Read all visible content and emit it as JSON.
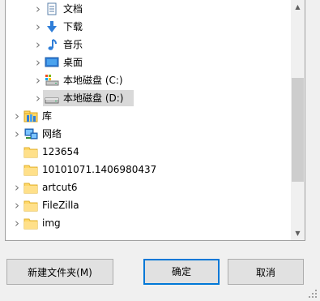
{
  "tree": {
    "items": [
      {
        "label": "文档",
        "icon": "document-icon",
        "expandable": true,
        "level": 2
      },
      {
        "label": "下载",
        "icon": "download-icon",
        "expandable": true,
        "level": 2
      },
      {
        "label": "音乐",
        "icon": "music-icon",
        "expandable": true,
        "level": 2
      },
      {
        "label": "桌面",
        "icon": "desktop-icon",
        "expandable": true,
        "level": 2
      },
      {
        "label": "本地磁盘 (C:)",
        "icon": "system-drive-icon",
        "expandable": true,
        "level": 2
      },
      {
        "label": "本地磁盘 (D:)",
        "icon": "drive-icon",
        "expandable": true,
        "level": 2,
        "selected": true
      },
      {
        "label": "库",
        "icon": "library-icon",
        "expandable": true,
        "level": 1
      },
      {
        "label": "网络",
        "icon": "network-icon",
        "expandable": true,
        "level": 1
      },
      {
        "label": "123654",
        "icon": "folder-icon",
        "expandable": false,
        "level": 1
      },
      {
        "label": "10101071.1406980437",
        "icon": "folder-icon",
        "expandable": false,
        "level": 1
      },
      {
        "label": "artcut6",
        "icon": "folder-icon",
        "expandable": true,
        "level": 1
      },
      {
        "label": "FileZilla",
        "icon": "folder-icon",
        "expandable": true,
        "level": 1
      },
      {
        "label": "img",
        "icon": "folder-icon",
        "expandable": true,
        "level": 1
      }
    ]
  },
  "buttons": {
    "new_folder": "新建文件夹(M)",
    "ok": "确定",
    "cancel": "取消"
  },
  "colors": {
    "accent": "#0078d7",
    "selection": "#d9d9d9",
    "folder": "#ffd766"
  }
}
